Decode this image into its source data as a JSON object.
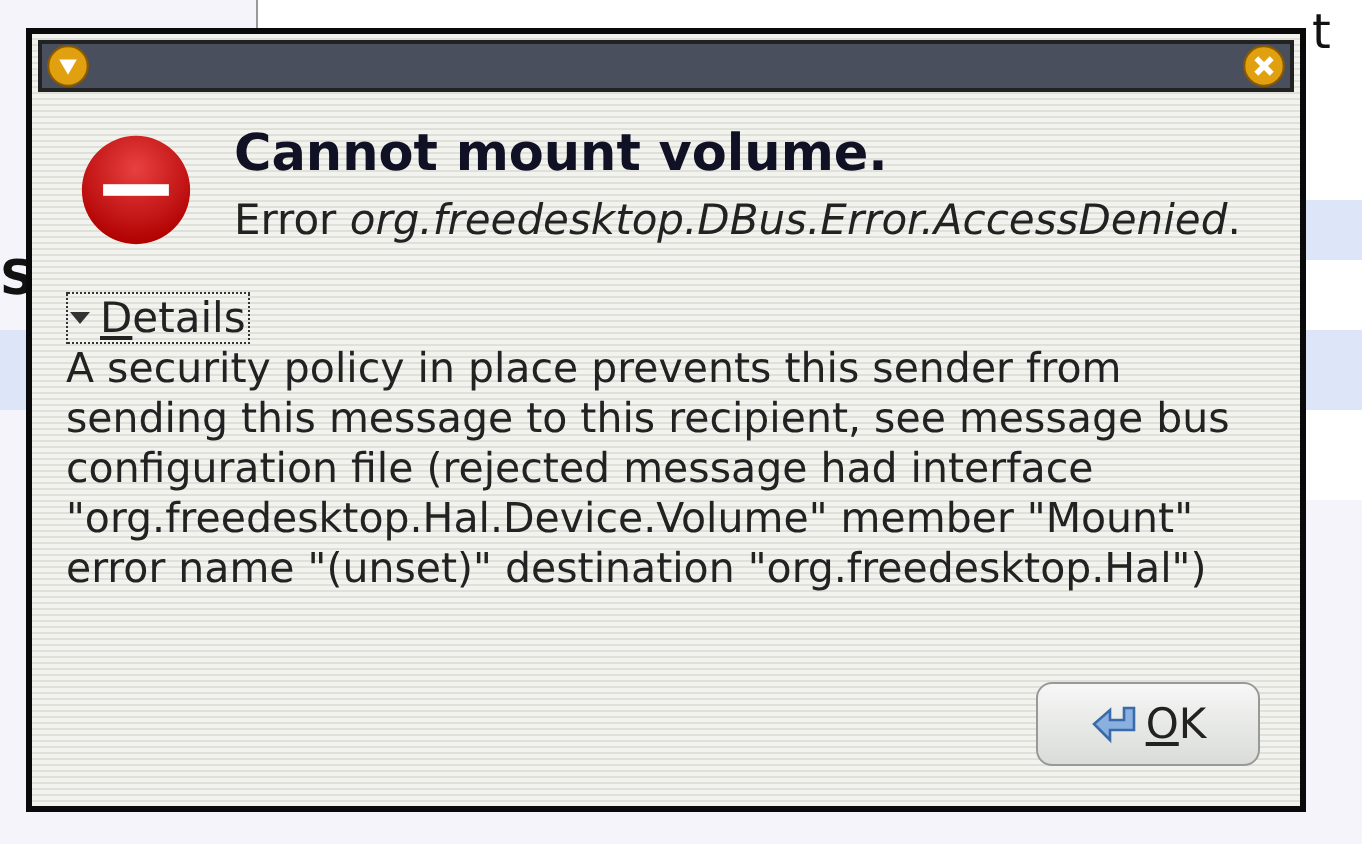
{
  "background": {
    "texts": [
      {
        "text": "t"
      },
      {
        "text": "S"
      }
    ]
  },
  "dialog": {
    "heading": "Cannot mount volume.",
    "message": "Error *org.freedesktop.DBus.Error.AccessDenied*.",
    "details": {
      "label": "Details",
      "expanded": true,
      "text": "A security policy in place prevents this sender from sending this message to this recipient, see message bus configuration file (rejected message had interface \"org.freedesktop.Hal.Device.Volume\" member \"Mount\" error name \"(unset)\" destination \"org.freedesktop.Hal\")"
    },
    "buttons": [
      {
        "label": "OK"
      }
    ]
  }
}
